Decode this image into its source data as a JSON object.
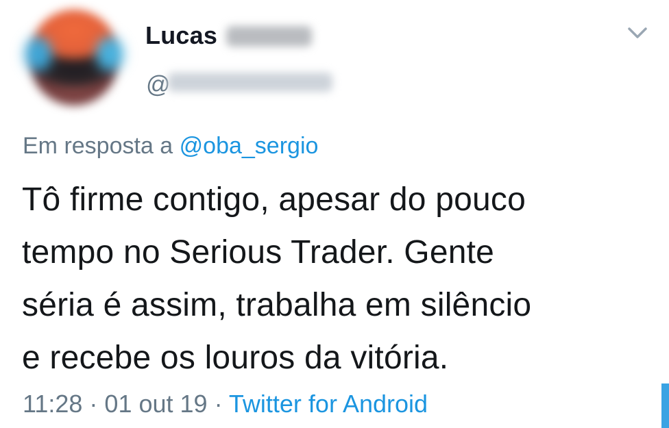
{
  "tweet": {
    "author_name": "Lucas",
    "handle_prefix": "@",
    "reply_prefix": "Em resposta a ",
    "reply_to": "@oba_sergio",
    "text_lines": [
      "Tô firme contigo, apesar do pouco",
      "tempo no Serious Trader. Gente",
      "séria é assim, trabalha em silêncio",
      "e recebe os louros da vitória."
    ],
    "time": "11:28",
    "separator": " · ",
    "date": "01 out 19",
    "source": "Twitter for Android"
  },
  "icons": {
    "menu": "chevron-down-icon"
  },
  "colors": {
    "text": "#14171a",
    "secondary": "#657786",
    "link": "#1b95e0"
  }
}
